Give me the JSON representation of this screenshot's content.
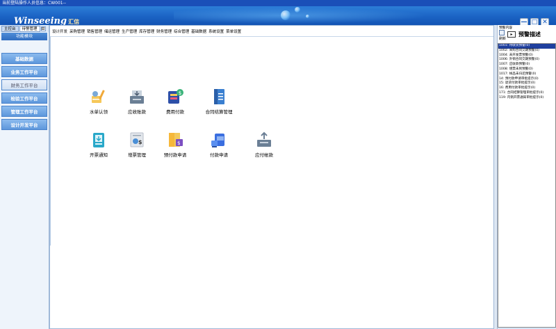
{
  "titlebar": {
    "text": "当前登陆操作人员信息：CW001--"
  },
  "banner": {
    "logo": "Winseeing",
    "logo_cn": "汇信"
  },
  "window_buttons": {
    "minimize": "—",
    "restore": "□",
    "close": "✕"
  },
  "left": {
    "tabs": [
      "主控台",
      "待警管理"
    ],
    "tab_close": "⊟",
    "module_header": "功能模块",
    "nav": [
      {
        "label": "基础数据",
        "active": true
      },
      {
        "label": "业务工作平台",
        "active": true
      },
      {
        "label": "财务工作平台",
        "active": false
      },
      {
        "label": "检验工作平台",
        "active": true
      },
      {
        "label": "管理工作平台",
        "active": true
      },
      {
        "label": "设计开发平台",
        "active": true
      }
    ]
  },
  "menu": [
    "设计开发",
    "采购管理",
    "销售管理",
    "储运管理",
    "生产管理",
    "库存管理",
    "财务管理",
    "综合管理",
    "基础数据",
    "系统设置",
    "菜单设置"
  ],
  "apps": [
    {
      "label": "水单认领",
      "icon": "claim-receipt-icon"
    },
    {
      "label": "应收账款",
      "icon": "receivable-icon"
    },
    {
      "label": "费用付款",
      "icon": "expense-payment-icon"
    },
    {
      "label": "合同结算管理",
      "icon": "contract-settlement-icon"
    },
    {
      "label": "开票通知",
      "icon": "invoice-notice-icon"
    },
    {
      "label": "增票管理",
      "icon": "vat-invoice-icon"
    },
    {
      "label": "预付款申请",
      "icon": "prepayment-icon"
    },
    {
      "label": "付款申请",
      "icon": "payment-request-icon"
    },
    {
      "label": "应付帐款",
      "icon": "payable-icon"
    }
  ],
  "right": {
    "header_small": "预警内容",
    "refresh": "刷新",
    "title": "预警描述",
    "items": [
      "1001: 待收货预警(0)",
      "1002: 采购合同交期预警(0)",
      "1004: 未开发票预警(0)",
      "1006: 外销合同交期预警(0)",
      "1007: 应收款预警(0)",
      "1008: 增票未到预警(0)",
      "1017: 样品未归还预警(0)",
      "14: 预付款申请审批提示(0)",
      "15: 退货付款审批提示(0)",
      "16: 费用付款审批提示(0)",
      "171: 合同结算管理审批提示(0)",
      "119: 内销开票通知审批提示(0)"
    ]
  }
}
